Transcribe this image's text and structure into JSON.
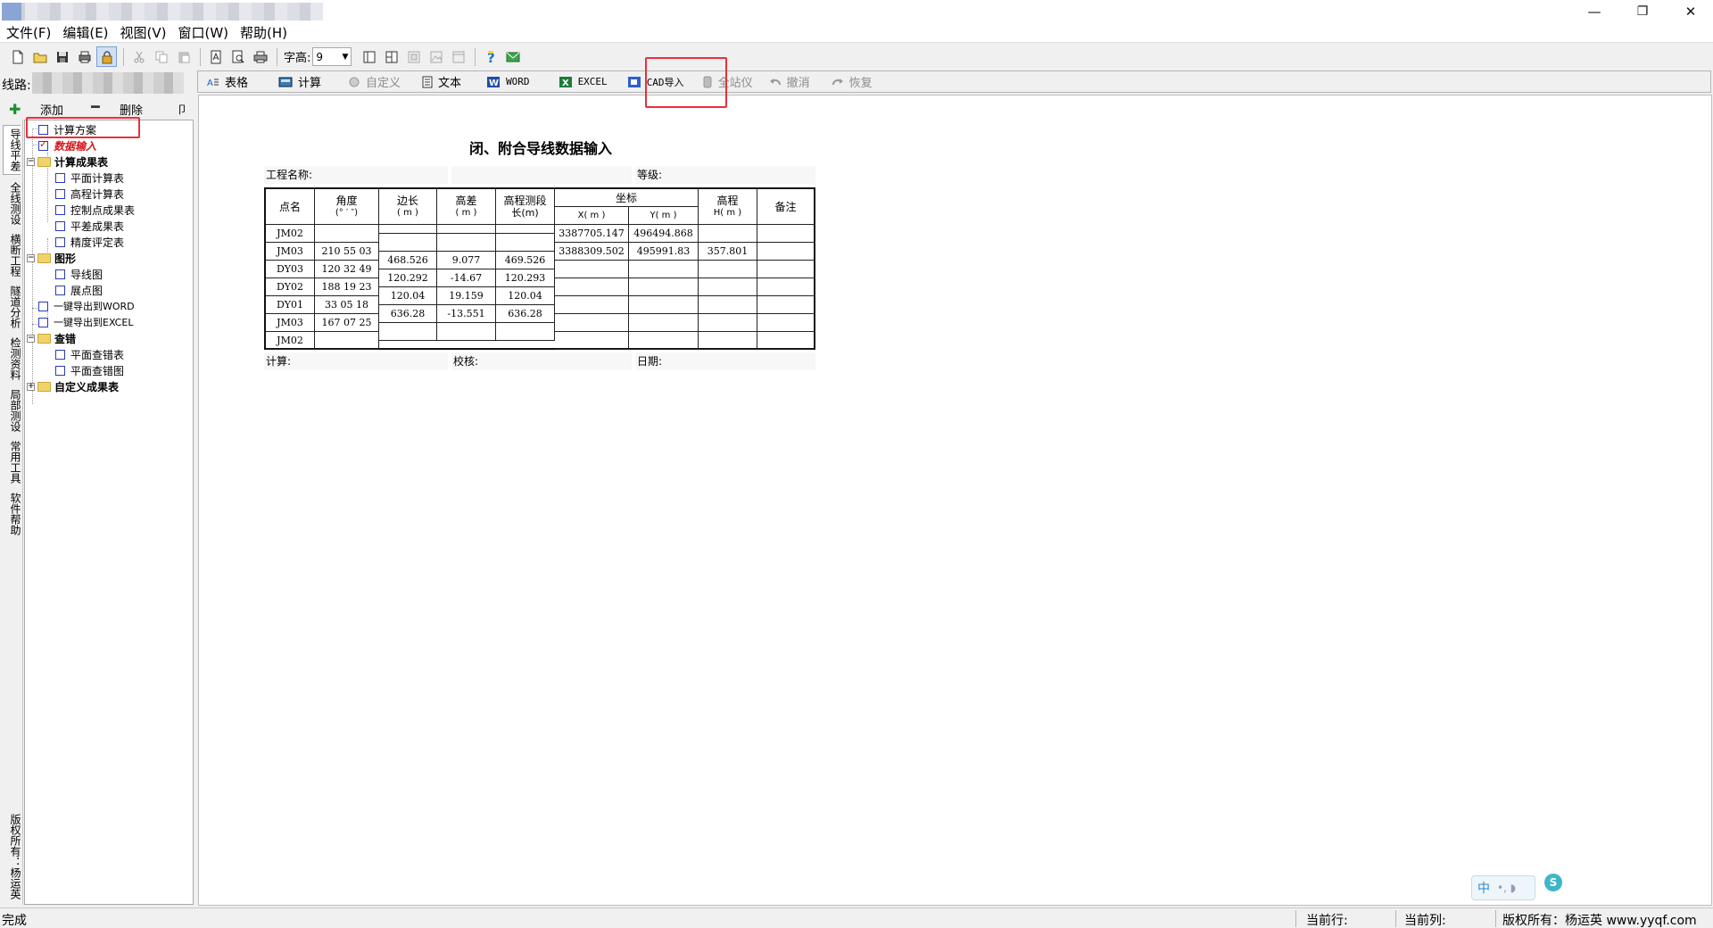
{
  "window": {
    "minimize": "—",
    "restore": "❐",
    "close": "✕"
  },
  "menu": [
    "文件(F)",
    "编辑(E)",
    "视图(V)",
    "窗口(W)",
    "帮助(H)"
  ],
  "toolbar": {
    "fontsize_label": "字高:",
    "fontsize_value": "9"
  },
  "route": {
    "label": "线路:"
  },
  "toolbar2": {
    "table": "表格",
    "calc": "计算",
    "custom": "自定义",
    "text": "文本",
    "word": "WORD",
    "excel": "EXCEL",
    "cad": "CAD导入",
    "total_station": "全站仪",
    "undo": "撤消",
    "redo": "恢复"
  },
  "panel": {
    "add": "添加",
    "delete": "删除",
    "pin": "卩"
  },
  "vtabs": [
    "导线平差",
    "全线测设",
    "横断工程",
    "隧道分析",
    "检测资料",
    "局部测设",
    "常用工具",
    "软件帮助",
    "版权所有：杨运英"
  ],
  "tree": {
    "scheme": "计算方案",
    "data_input": "数据输入",
    "results": "计算成果表",
    "plane_calc": "平面计算表",
    "elev_calc": "高程计算表",
    "control_points": "控制点成果表",
    "adjust_results": "平差成果表",
    "precision": "精度评定表",
    "graphics": "图形",
    "traverse_map": "导线图",
    "point_map": "展点图",
    "export_word": "一键导出到WORD",
    "export_excel": "一键导出到EXCEL",
    "check": "查错",
    "plane_check_table": "平面查错表",
    "plane_check_map": "平面查错图",
    "custom_results": "自定义成果表"
  },
  "document": {
    "title": "闭、附合导线数据输入",
    "project_label": "工程名称:",
    "grade_label": "等级:",
    "calc_label": "计算:",
    "check_label": "校核:",
    "date_label": "日期:",
    "headers": {
      "point": "点名",
      "angle": "角度",
      "angle_unit": "(° ′ ″)",
      "side": "边长",
      "side_unit": "( m )",
      "dh": "高差",
      "dh_unit": "( m )",
      "elev_len": "高程测段",
      "elev_len_unit": "长(m)",
      "coord": "坐标",
      "x": "X( m )",
      "y": "Y( m )",
      "elev": "高程",
      "elev_unit": "H( m )",
      "remark": "备注"
    },
    "points": [
      {
        "name": "JM02",
        "angle": "",
        "x": "3387705.147",
        "y": "496494.868",
        "h": ""
      },
      {
        "name": "JM03",
        "angle": "210 55 03",
        "x": "3388309.502",
        "y": "495991.83",
        "h": "357.801"
      },
      {
        "name": "DY03",
        "angle": "120 32 49",
        "x": "",
        "y": "",
        "h": ""
      },
      {
        "name": "DY02",
        "angle": "188 19 23",
        "x": "",
        "y": "",
        "h": ""
      },
      {
        "name": "DY01",
        "angle": "33 05 18",
        "x": "",
        "y": "",
        "h": ""
      },
      {
        "name": "JM03",
        "angle": "167 07 25",
        "x": "",
        "y": "",
        "h": ""
      },
      {
        "name": "JM02",
        "angle": "",
        "x": "",
        "y": "",
        "h": ""
      }
    ],
    "legs": [
      {
        "side": "",
        "dh": "",
        "len": ""
      },
      {
        "side": "468.526",
        "dh": "9.077",
        "len": "469.526"
      },
      {
        "side": "120.292",
        "dh": "-14.67",
        "len": "120.293"
      },
      {
        "side": "120.04",
        "dh": "19.159",
        "len": "120.04"
      },
      {
        "side": "636.28",
        "dh": "-13.551",
        "len": "636.28"
      },
      {
        "side": "",
        "dh": "",
        "len": ""
      }
    ]
  },
  "status": {
    "ready": "完成",
    "cur_row": "当前行:",
    "cur_col": "当前列:",
    "copyright": "版权所有：杨运英 www.yyqf.com"
  },
  "ime": {
    "mode": "中",
    "extra": "•,  ◗",
    "badge": "S"
  }
}
